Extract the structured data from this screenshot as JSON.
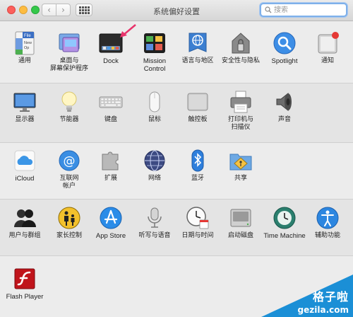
{
  "window": {
    "title": "系统偏好设置",
    "nav_back": "‹",
    "nav_forward": "›",
    "search_placeholder": "搜索"
  },
  "rows": [
    {
      "items": [
        {
          "label": "通用",
          "icon": "general-icon"
        },
        {
          "label": "桌面与\n屏幕保护程序",
          "icon": "desktop-screensaver-icon"
        },
        {
          "label": "Dock",
          "icon": "dock-icon"
        },
        {
          "label": "Mission\nControl",
          "icon": "mission-control-icon"
        },
        {
          "label": "语言与地区",
          "icon": "language-region-icon"
        },
        {
          "label": "安全性与隐私",
          "icon": "security-privacy-icon"
        },
        {
          "label": "Spotlight",
          "icon": "spotlight-icon"
        },
        {
          "label": "通知",
          "icon": "notifications-icon"
        }
      ]
    },
    {
      "items": [
        {
          "label": "显示器",
          "icon": "displays-icon"
        },
        {
          "label": "节能器",
          "icon": "energy-saver-icon"
        },
        {
          "label": "键盘",
          "icon": "keyboard-icon"
        },
        {
          "label": "鼠标",
          "icon": "mouse-icon"
        },
        {
          "label": "触控板",
          "icon": "trackpad-icon"
        },
        {
          "label": "打印机与\n扫描仪",
          "icon": "printers-scanners-icon"
        },
        {
          "label": "声音",
          "icon": "sound-icon"
        }
      ]
    },
    {
      "items": [
        {
          "label": "iCloud",
          "icon": "icloud-icon"
        },
        {
          "label": "互联网\n帐户",
          "icon": "internet-accounts-icon"
        },
        {
          "label": "扩展",
          "icon": "extensions-icon"
        },
        {
          "label": "网络",
          "icon": "network-icon"
        },
        {
          "label": "蓝牙",
          "icon": "bluetooth-icon"
        },
        {
          "label": "共享",
          "icon": "sharing-icon"
        }
      ]
    },
    {
      "items": [
        {
          "label": "用户与群组",
          "icon": "users-groups-icon"
        },
        {
          "label": "家长控制",
          "icon": "parental-controls-icon"
        },
        {
          "label": "App Store",
          "icon": "app-store-icon"
        },
        {
          "label": "听写与语音",
          "icon": "dictation-speech-icon"
        },
        {
          "label": "日期与时间",
          "icon": "date-time-icon"
        },
        {
          "label": "启动磁盘",
          "icon": "startup-disk-icon"
        },
        {
          "label": "Time Machine",
          "icon": "time-machine-icon"
        },
        {
          "label": "辅助功能",
          "icon": "accessibility-icon"
        }
      ]
    },
    {
      "items": [
        {
          "label": "Flash Player",
          "icon": "flash-player-icon"
        }
      ]
    }
  ],
  "general_icon_text": {
    "line1": "File",
    "line2": "New",
    "line3": "Op"
  },
  "watermark": {
    "line1": "格子啦",
    "line2": "gezila.com"
  },
  "colors": {
    "accent": "#1b8fd6",
    "arrow": "#e8336b"
  }
}
